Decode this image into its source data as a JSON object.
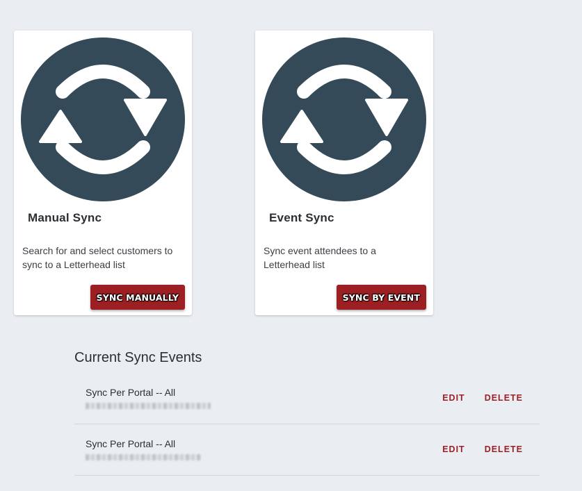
{
  "cards": [
    {
      "title": "Manual Sync",
      "description": "Search for and select customers to sync to a Letterhead list",
      "button_label": "SYNC MANUALLY",
      "icon": "sync-icon"
    },
    {
      "title": "Event Sync",
      "description": "Sync event attendees to a Letterhead list",
      "button_label": "SYNC BY EVENT",
      "icon": "sync-icon"
    }
  ],
  "current_events": {
    "title": "Current Sync Events",
    "items": [
      {
        "name": "Sync Per Portal -- All",
        "edit_label": "EDIT",
        "delete_label": "DELETE"
      },
      {
        "name": "Sync Per Portal -- All",
        "edit_label": "EDIT",
        "delete_label": "DELETE"
      }
    ]
  },
  "colors": {
    "background": "#eaeef2",
    "icon_circle": "#344a58",
    "accent": "#9b1f23",
    "card": "#ffffff"
  }
}
